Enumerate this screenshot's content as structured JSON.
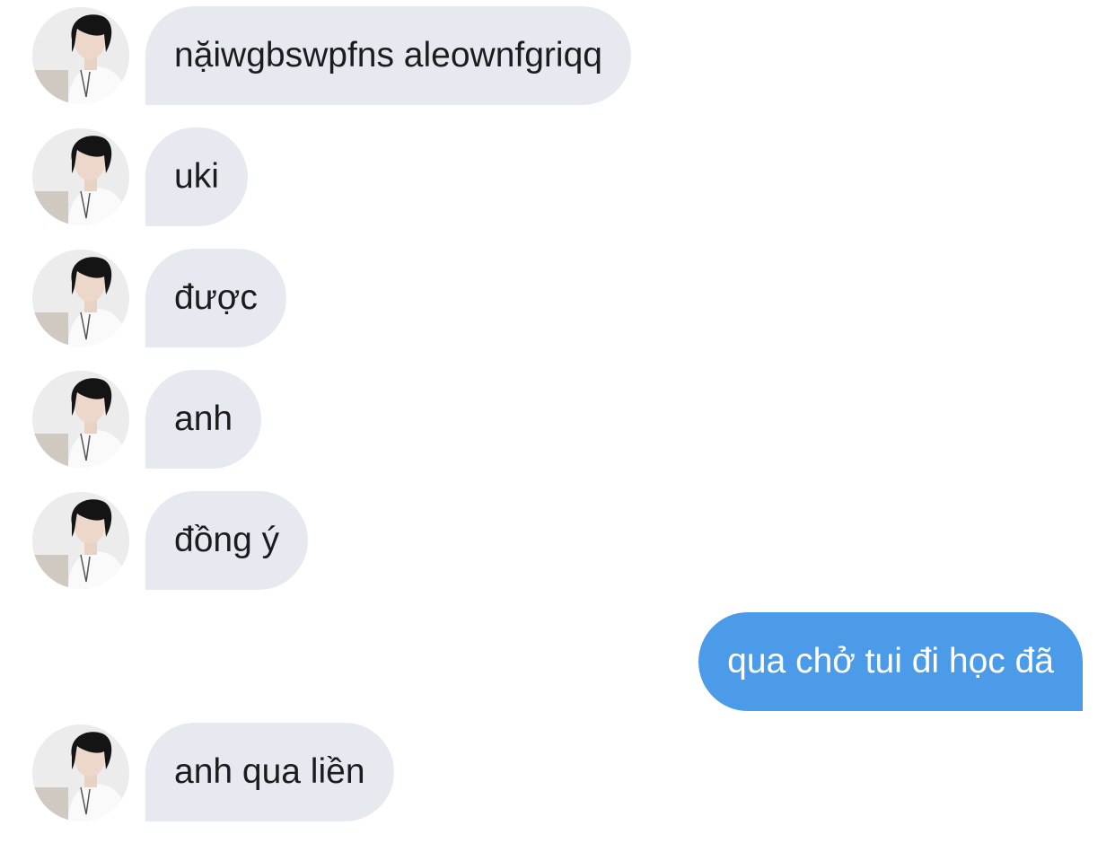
{
  "chat": {
    "messages": [
      {
        "sender": "other",
        "text": "nặiwgbswpfns aleownfgriqq"
      },
      {
        "sender": "other",
        "text": "uki"
      },
      {
        "sender": "other",
        "text": "được"
      },
      {
        "sender": "other",
        "text": "anh"
      },
      {
        "sender": "other",
        "text": "đồng ý"
      },
      {
        "sender": "me",
        "text": "qua chở tui đi học đã"
      },
      {
        "sender": "other",
        "text": "anh qua liền"
      }
    ]
  },
  "colors": {
    "incoming_bubble": "#e6e9ef",
    "outgoing_bubble": "#4c9be8",
    "incoming_text": "#1c1c1e",
    "outgoing_text": "#ffffff"
  },
  "icons": {
    "avatar": "profile-photo-avatar"
  }
}
